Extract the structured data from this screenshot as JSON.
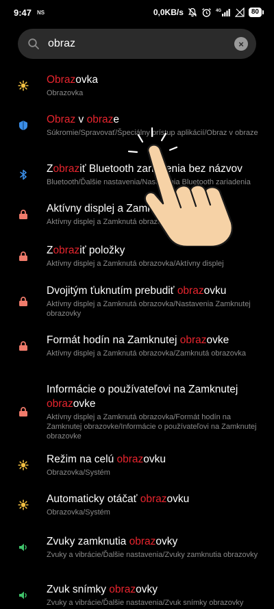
{
  "status": {
    "time": "9:47",
    "ns": "NS",
    "speed": "0,0KB/s",
    "network": "4G",
    "battery": "80"
  },
  "search": {
    "value": "obraz",
    "placeholder": ""
  },
  "colors": {
    "highlight": "#e8252e",
    "display_icon": "#f5c242",
    "privacy_icon": "#3b8ee8",
    "bluetooth_icon": "#3b8ee8",
    "lock_icon": "#f07b6b",
    "sound_icon": "#3fc26a"
  },
  "results": [
    {
      "icon": "brightness-icon",
      "title_parts": [
        "",
        "Obraz",
        "ovka"
      ],
      "sub": "Obrazovka"
    },
    {
      "icon": "shield-icon",
      "title_parts": [
        "",
        "Obraz",
        " v ",
        "obraz",
        "e"
      ],
      "sub": "Súkromie/Spravovať/Špeciálny prístup aplikácií/Obraz v obraze"
    },
    {
      "icon": "bluetooth-icon",
      "title_parts": [
        "Z",
        "obraz",
        "iť Bluetooth zariadenia bez názvov"
      ],
      "sub": "Bluetooth/Ďalšie nastavenia/Nastavenia Bluetooth zariadenia"
    },
    {
      "icon": "lock-icon",
      "title_parts": [
        "Aktívny displej a Zamknutá obrazovka"
      ],
      "sub": "Aktívny displej a Zamknutá obrazovka"
    },
    {
      "icon": "lock-icon",
      "title_parts": [
        "Z",
        "obraz",
        "iť položky"
      ],
      "sub": "Aktívny displej a Zamknutá obrazovka/Aktívny displej"
    },
    {
      "icon": "lock-icon",
      "title_parts": [
        "Dvojitým ťuknutím prebudiť ",
        "obraz",
        "ovku"
      ],
      "sub": "Aktívny displej a Zamknutá obrazovka/Nastavenia Zamknutej obrazovky"
    },
    {
      "icon": "lock-icon",
      "title_parts": [
        "Formát hodín na Zamknutej ",
        "obraz",
        "ovke"
      ],
      "sub": "Aktívny displej a Zamknutá obrazovka/Zamknutá obrazovka"
    },
    {
      "icon": "lock-icon",
      "title_parts": [
        "Informácie o používateľovi na Zamknutej ",
        "obraz",
        "ovke"
      ],
      "sub": "Aktívny displej a Zamknutá obrazovka/Formát hodín na Zamknutej obrazovke/Informácie o používateľovi na Zamknutej obrazovke"
    },
    {
      "icon": "brightness-icon",
      "title_parts": [
        "Režim na celú ",
        "obraz",
        "ovku"
      ],
      "sub": "Obrazovka/Systém"
    },
    {
      "icon": "brightness-icon",
      "title_parts": [
        "Automaticky otáčať ",
        "obraz",
        "ovku"
      ],
      "sub": "Obrazovka/Systém"
    },
    {
      "icon": "speaker-icon",
      "title_parts": [
        "Zvuky zamknutia ",
        "obraz",
        "ovky"
      ],
      "sub": "Zvuky a vibrácie/Ďalšie nastavenia/Zvuky zamknutia obrazovky"
    },
    {
      "icon": "speaker-icon",
      "title_parts": [
        "Zvuk snímky ",
        "obraz",
        "ovky"
      ],
      "sub": "Zvuky a vibrácie/Ďalšie nastavenia/Zvuk snímky obrazovky"
    }
  ]
}
